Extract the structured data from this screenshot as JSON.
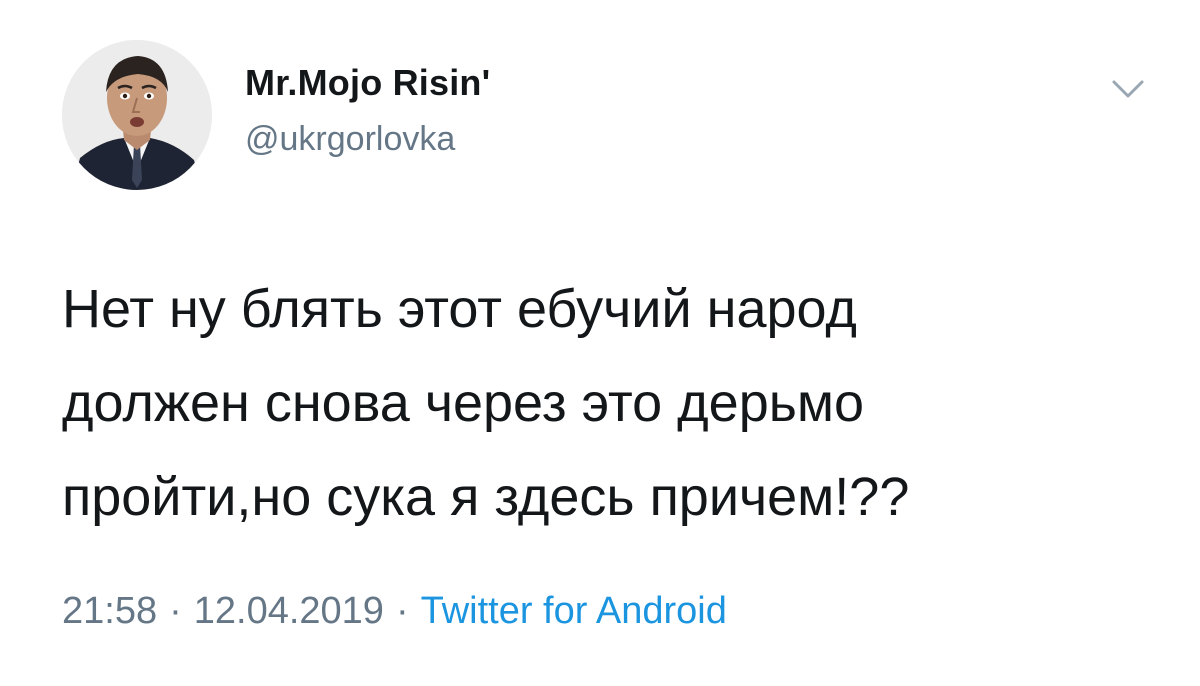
{
  "tweet": {
    "author": {
      "display_name": "Mr.Mojo Risin'",
      "handle": "@ukrgorlovka"
    },
    "text": "Нет ну блять этот ебучий народ\nдолжен снова через это дерьмо\nпройти,но сука я здесь причем!??",
    "time": "21:58",
    "date": "12.04.2019",
    "separator": "·",
    "source": "Twitter for Android",
    "menu_icon": "chevron-down-icon"
  },
  "colors": {
    "text": "#14171a",
    "secondary": "#657786",
    "link": "#1b95e0",
    "background": "#ffffff"
  }
}
